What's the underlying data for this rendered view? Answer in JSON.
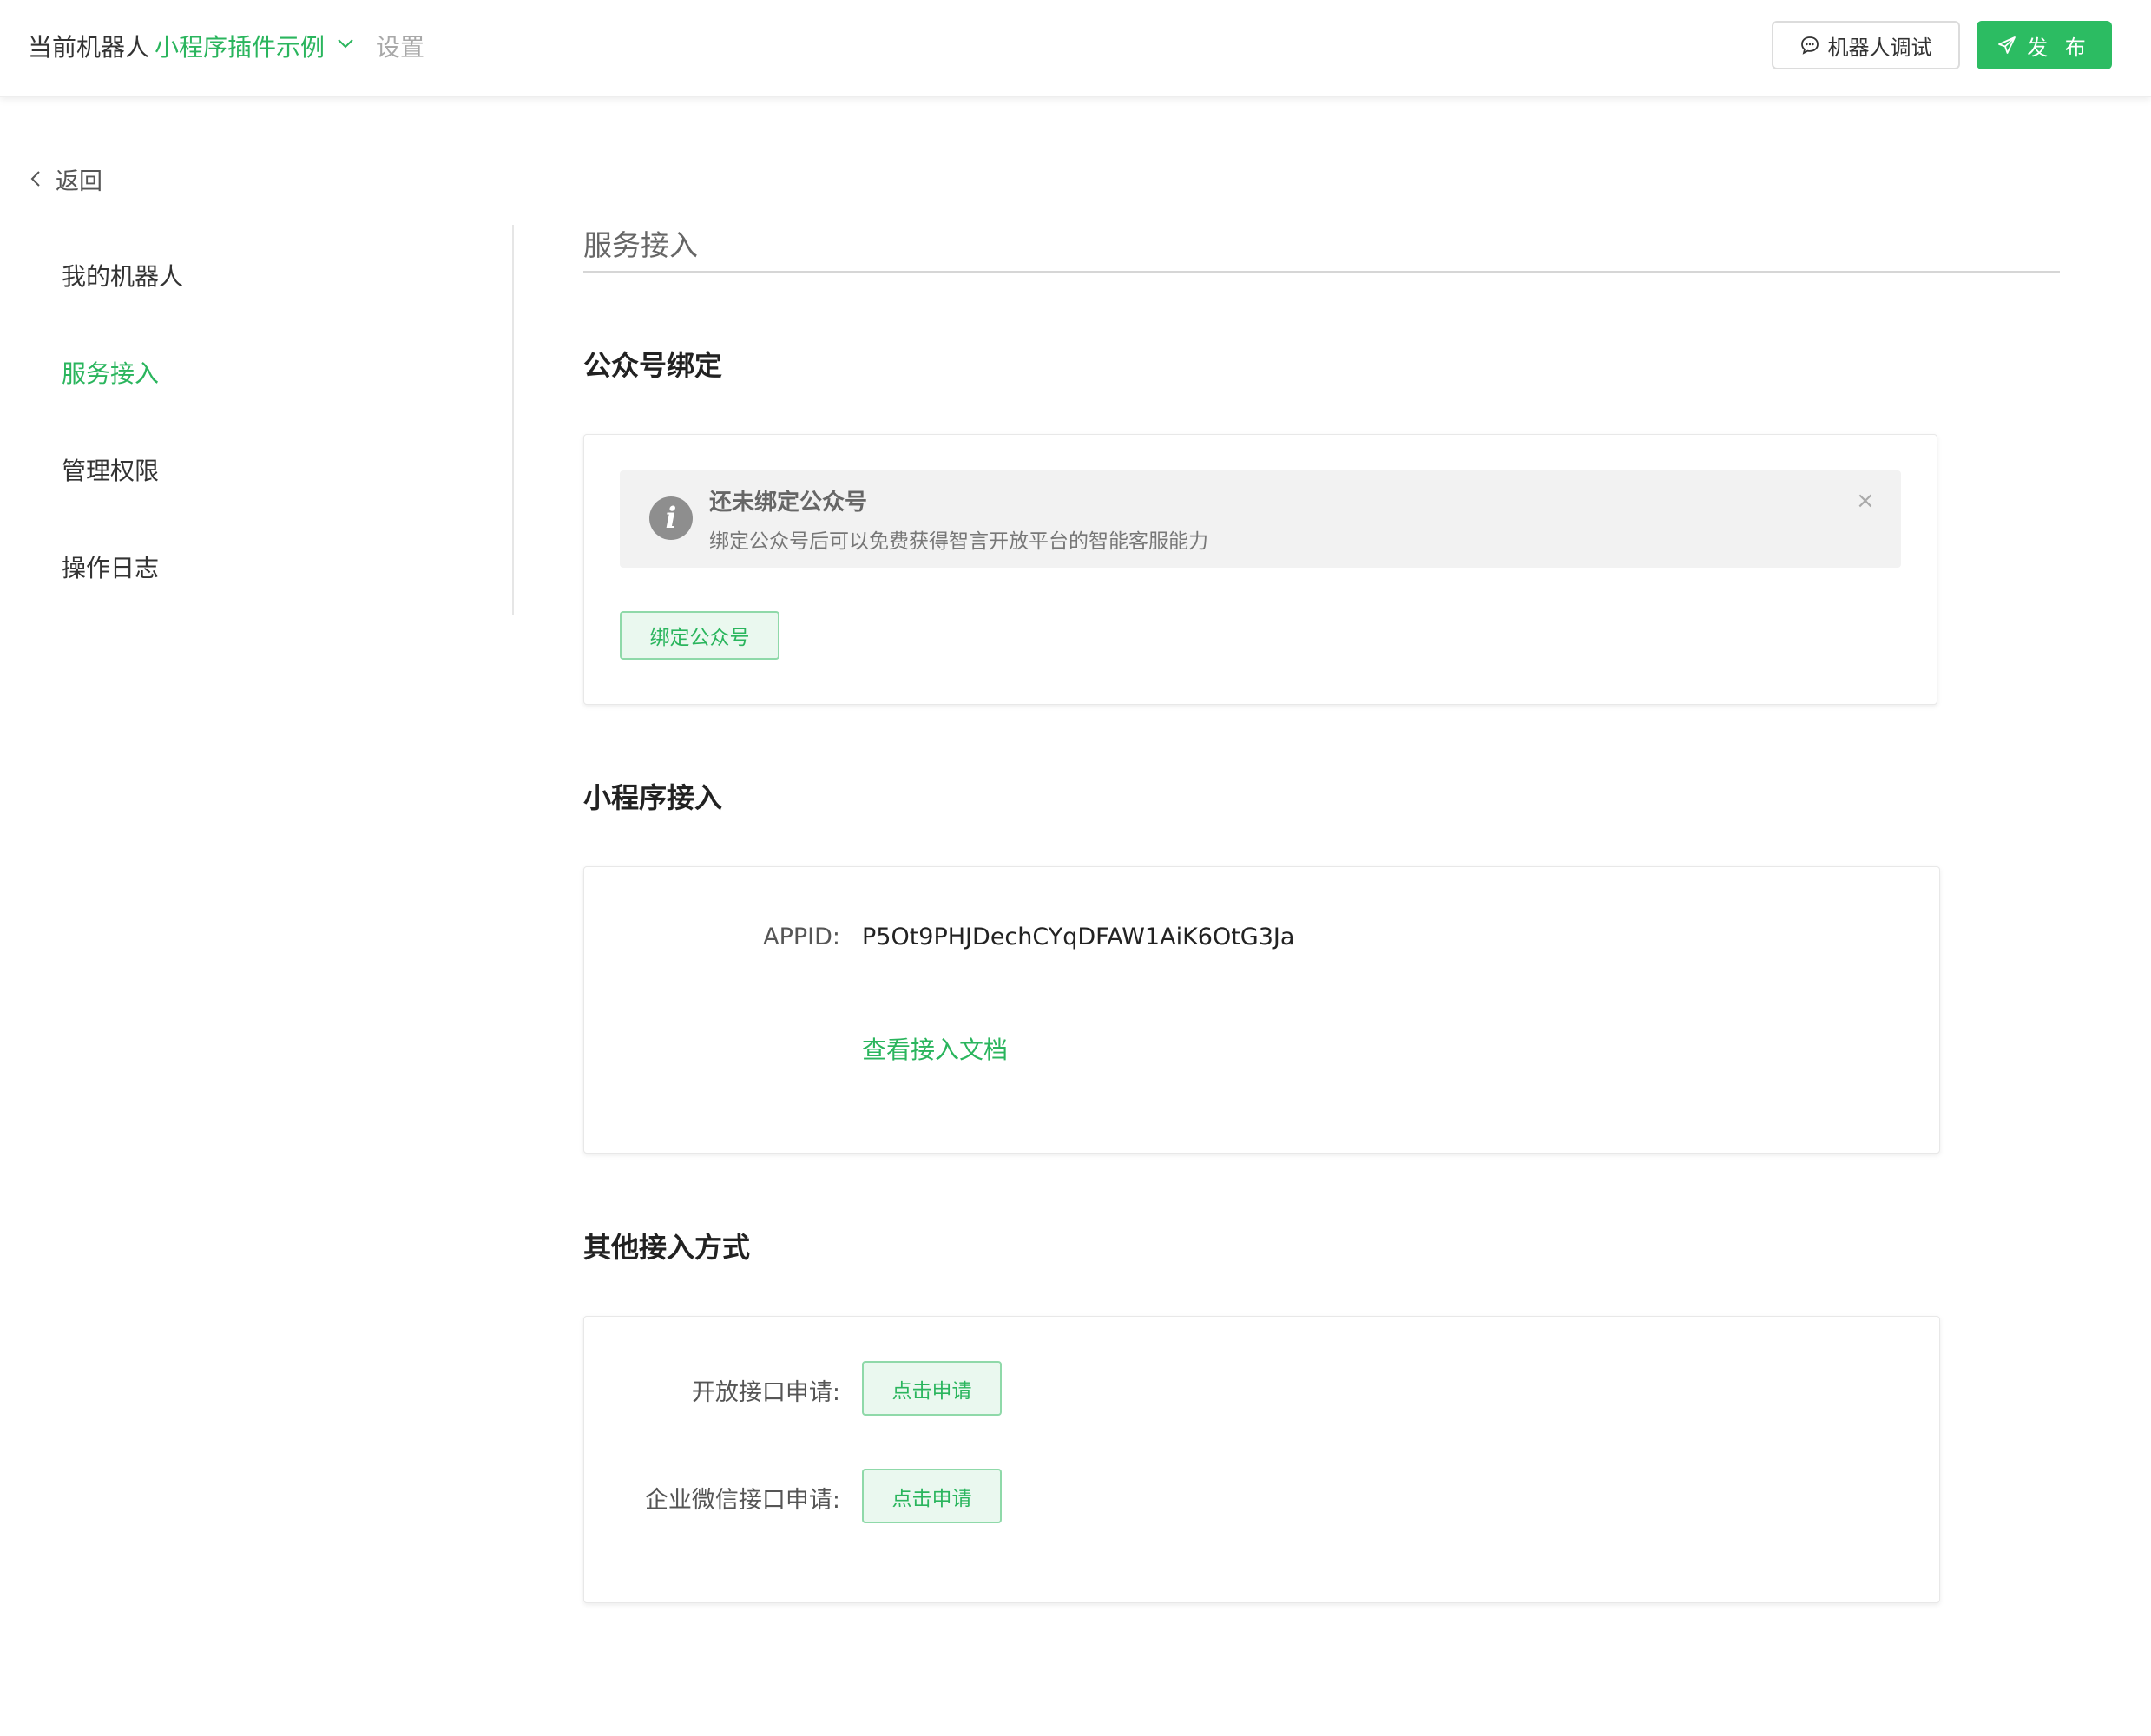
{
  "header": {
    "current_robot_label": "当前机器人",
    "robot_name": "小程序插件示例",
    "settings_label": "设置",
    "debug_button_label": "机器人调试",
    "publish_button_label": "发 布"
  },
  "sidebar": {
    "back_label": "返回",
    "items": [
      {
        "label": "我的机器人",
        "active": false
      },
      {
        "label": "服务接入",
        "active": true
      },
      {
        "label": "管理权限",
        "active": false
      },
      {
        "label": "操作日志",
        "active": false
      }
    ]
  },
  "main": {
    "page_title": "服务接入",
    "official_account": {
      "heading": "公众号绑定",
      "alert_title": "还未绑定公众号",
      "alert_desc": "绑定公众号后可以免费获得智言开放平台的智能客服能力",
      "alert_close": "×",
      "bind_button_label": "绑定公众号"
    },
    "mini_program": {
      "heading": "小程序接入",
      "appid_label": "APPID:",
      "appid_value": "P5Ot9PHJDechCYqDFAW1AiK6OtG3Ja",
      "doc_link_label": "查看接入文档"
    },
    "other_access": {
      "heading": "其他接入方式",
      "rows": [
        {
          "label": "开放接口申请:",
          "button_label": "点击申请"
        },
        {
          "label": "企业微信接口申请:",
          "button_label": "点击申请"
        }
      ]
    }
  },
  "colors": {
    "accent_green": "#2cbc62",
    "link_green": "#2ab55d"
  },
  "icons": [
    "chevron-down-icon",
    "chat-bubble-icon",
    "send-icon",
    "chevron-left-icon",
    "info-icon",
    "close-icon"
  ]
}
